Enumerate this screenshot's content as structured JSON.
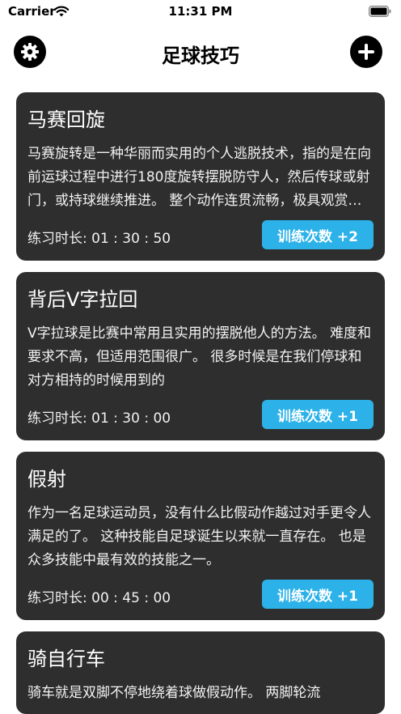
{
  "status_bar": {
    "carrier": "Carrier",
    "time": "11:31 PM"
  },
  "nav": {
    "title": "足球技巧",
    "left_icon": "gear-icon",
    "right_icon": "plus-icon"
  },
  "cards": [
    {
      "title": "马赛回旋",
      "description": "马赛旋转是一种华丽而实用的个人逃脱技术，指的是在向前运球过程中进行180度旋转摆脱防守人，然后传球或射门，或持球继续推进。 整个动作连贯流畅，极具观赏性。",
      "duration": "练习时长: 01 : 30 : 50",
      "button": "训练次数 +2"
    },
    {
      "title": "背后V字拉回",
      "description": "V字拉球是比赛中常用且实用的摆脱他人的方法。 难度和要求不高，但适用范围很广。 很多时候是在我们停球和对方相持的时候用到的",
      "duration": "练习时长: 01 : 30 : 00",
      "button": "训练次数 +1"
    },
    {
      "title": "假射",
      "description": "作为一名足球运动员，没有什么比假动作越过对手更令人满足的了。 这种技能自足球诞生以来就一直存在。 也是众多技能中最有效的技能之一。",
      "duration": "练习时长: 00 : 45 : 00",
      "button": "训练次数 +1"
    },
    {
      "title": "骑自行车",
      "description": "骑车就是双脚不停地绕着球做假动作。 两脚轮流",
      "duration": "",
      "button": ""
    }
  ],
  "colors": {
    "card_bg": "#2e2e2e",
    "accent": "#2cb2e8"
  }
}
